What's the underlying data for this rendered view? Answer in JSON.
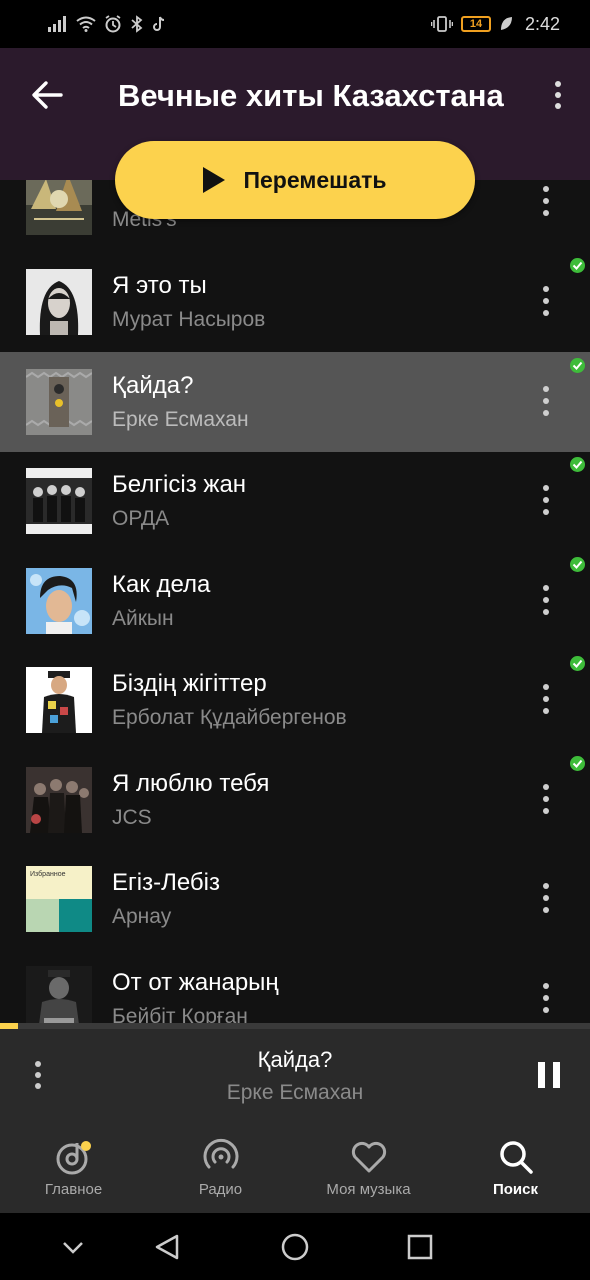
{
  "status_bar": {
    "battery": "14",
    "time": "2:42"
  },
  "header": {
    "title": "Вечные хиты Казахстана"
  },
  "shuffle": {
    "label": "Перемешать"
  },
  "tracks": [
    {
      "title": "",
      "artist": "Metis's",
      "cached": false,
      "active": false
    },
    {
      "title": "Я это ты",
      "artist": "Мурат Насыров",
      "cached": true,
      "active": false
    },
    {
      "title": "Қайда?",
      "artist": "Ерке Есмахан",
      "cached": true,
      "active": true
    },
    {
      "title": "Белгісіз жан",
      "artist": "ОРДА",
      "cached": true,
      "active": false
    },
    {
      "title": "Как дела",
      "artist": "Айкын",
      "cached": true,
      "active": false
    },
    {
      "title": "Біздің жігіттер",
      "artist": "Ерболат Құдайбергенов",
      "cached": true,
      "active": false
    },
    {
      "title": "Я люблю тебя",
      "artist": "JCS",
      "cached": true,
      "active": false
    },
    {
      "title": "Егіз-Лебіз",
      "artist": "Арнау",
      "cached": false,
      "active": false
    },
    {
      "title": "От от жанарың",
      "artist": "Бейбіт Корған",
      "cached": false,
      "active": false
    }
  ],
  "cover_texts": {
    "izbrannoe": "Избранное"
  },
  "now_playing": {
    "title": "Қайда?",
    "artist": "Ерке Есмахан",
    "progress": 0.03
  },
  "bottom_nav": [
    {
      "label": "Главное",
      "icon": "home-disc-icon",
      "selected": false
    },
    {
      "label": "Радио",
      "icon": "radio-icon",
      "selected": false
    },
    {
      "label": "Моя музыка",
      "icon": "heart-icon",
      "selected": false
    },
    {
      "label": "Поиск",
      "icon": "search-icon",
      "selected": true
    }
  ],
  "colors": {
    "accent": "#fcd24d",
    "header_bg": "#2b1a2c",
    "cached_green": "#3ebc3a",
    "active_row": "#555555"
  }
}
